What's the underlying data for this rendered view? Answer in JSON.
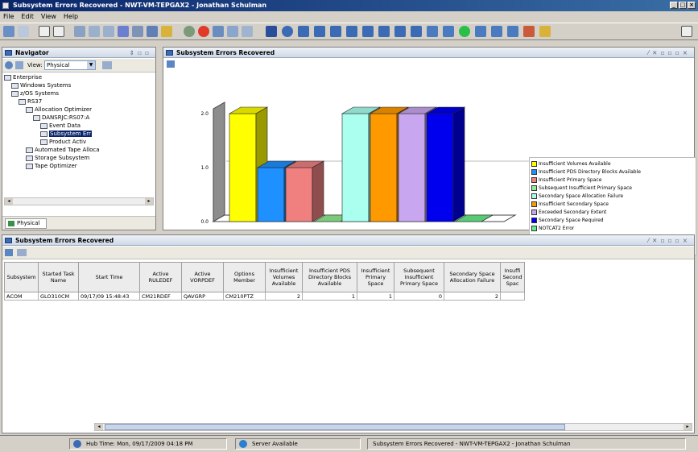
{
  "window": {
    "title": "Subsystem Errors Recovered - NWT-VM-TEPGAX2 - Jonathan Schulman"
  },
  "menu": [
    "File",
    "Edit",
    "View",
    "Help"
  ],
  "navigator": {
    "title": "Navigator",
    "view_label": "View:",
    "view_value": "Physical",
    "tab_label": "Physical",
    "tree": [
      {
        "label": "Enterprise",
        "indent": 0
      },
      {
        "label": "Windows Systems",
        "indent": 1
      },
      {
        "label": "z/OS Systems",
        "indent": 1
      },
      {
        "label": "RS37",
        "indent": 2
      },
      {
        "label": "Allocation Optimizer",
        "indent": 3
      },
      {
        "label": "DANSRJC:RS07:A",
        "indent": 4
      },
      {
        "label": "Event Data",
        "indent": 5
      },
      {
        "label": "Subsystem Err",
        "indent": 5,
        "selected": true
      },
      {
        "label": "Product Activ",
        "indent": 5
      },
      {
        "label": "Automated Tape Alloca",
        "indent": 3
      },
      {
        "label": "Storage Subsystem",
        "indent": 3
      },
      {
        "label": "Tape Optimizer",
        "indent": 3
      }
    ]
  },
  "chart_panel": {
    "title": "Subsystem Errors Recovered"
  },
  "chart_data": {
    "type": "bar",
    "y_ticks": [
      "2.0",
      "1.0",
      "0.0"
    ],
    "ylim": [
      0,
      2
    ],
    "series": [
      {
        "name": "Insufficient Volumes Available",
        "value": 2,
        "color": "#ffff00"
      },
      {
        "name": "Insufficient PDS Directory Blocks Available",
        "value": 1,
        "color": "#1e90ff"
      },
      {
        "name": "Insufficient Primary Space",
        "value": 1,
        "color": "#f08080"
      },
      {
        "name": "Subsequent Insufficient Primary Space",
        "value": 0,
        "color": "#90ee90"
      },
      {
        "name": "Secondary Space Allocation Failure",
        "value": 2,
        "color": "#aaffee"
      },
      {
        "name": "Insufficient Secondary Space",
        "value": 2,
        "color": "#ff9900"
      },
      {
        "name": "Exceeded Secondary Extent",
        "value": 2,
        "color": "#c9a6f0"
      },
      {
        "name": "Secondary Space Required",
        "value": 2,
        "color": "#0000ee"
      },
      {
        "name": "NOTCAT2 Error",
        "value": 0,
        "color": "#66ee88"
      }
    ]
  },
  "table_panel": {
    "title": "Subsystem Errors Recovered",
    "columns": [
      "Subsystem",
      "Started Task Name",
      "Start Time",
      "Active RULEDEF",
      "Active VORPDEF",
      "Options Member",
      "Insufficient Volumes Available",
      "Insufficient PDS Directory Blocks Available",
      "Insufficient Primary Space",
      "Subsequent Insufficient Primary Space",
      "Secondary Space Allocation Failure",
      "Insuffi Second Spac"
    ],
    "rows": [
      [
        "ACOM",
        "GLO310CM",
        "09/17/09 15:48:43",
        "CM21RDEF",
        "QAVGRP",
        "CM210PTZ",
        "2",
        "1",
        "1",
        "0",
        "2",
        ""
      ]
    ]
  },
  "status": {
    "hub_time": "Hub Time: Mon, 09/17/2009 04:18 PM",
    "server": "Server Available",
    "workspace": "Subsystem Errors Recovered - NWT-VM-TEPGAX2 - Jonathan Schulman"
  }
}
